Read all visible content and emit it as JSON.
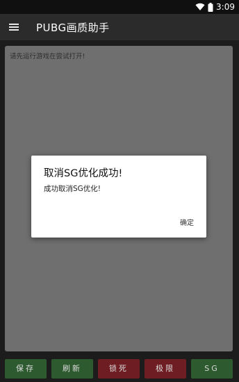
{
  "status_bar": {
    "time": "3:09"
  },
  "app_bar": {
    "title": "PUBG画质助手",
    "menu_icon": "hamburger-menu-icon"
  },
  "panel": {
    "message": "请先运行游戏在尝试打开!"
  },
  "buttons": [
    {
      "label": "保存",
      "color": "#2d5a2e"
    },
    {
      "label": "刷新",
      "color": "#2d5a2e"
    },
    {
      "label": "锁死",
      "color": "#6e1d22"
    },
    {
      "label": "极限",
      "color": "#6e1d22"
    },
    {
      "label": "SG",
      "color": "#2d5a2e"
    }
  ],
  "dialog": {
    "title": "取消SG优化成功!",
    "message": "成功取消SG优化!",
    "ok_label": "确定"
  }
}
